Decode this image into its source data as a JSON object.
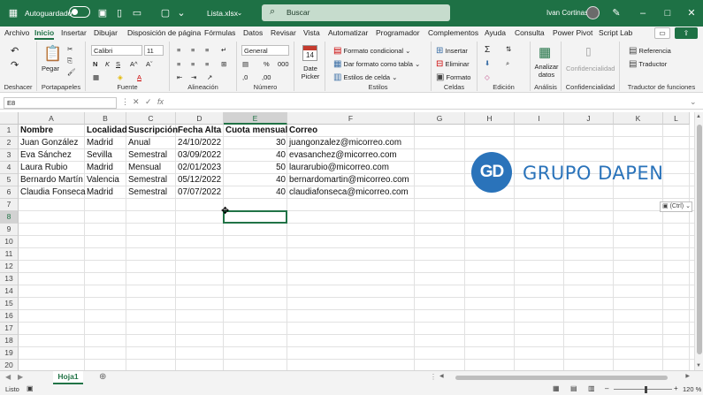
{
  "titlebar": {
    "autosave_label": "Autoguardado",
    "file_name": "Lista.xlsx",
    "search_placeholder": "Buscar",
    "user_name": "Ivan Cortinas"
  },
  "menu": {
    "tabs": [
      "Archivo",
      "Inicio",
      "Insertar",
      "Dibujar",
      "Disposición de página",
      "Fórmulas",
      "Datos",
      "Revisar",
      "Vista",
      "Automatizar",
      "Programador",
      "Complementos",
      "Ayuda",
      "Consulta",
      "Power Pivot",
      "Script Lab"
    ],
    "active_tab": "Inicio"
  },
  "ribbon": {
    "undo_group": "Deshacer",
    "clipboard": {
      "label": "Portapapeles",
      "paste": "Pegar"
    },
    "font": {
      "label": "Fuente",
      "name": "Calibri",
      "size": "11"
    },
    "alignment": {
      "label": "Alineación"
    },
    "number": {
      "label": "Número",
      "format": "General"
    },
    "date": {
      "day": "14",
      "label": "Date Picker"
    },
    "styles": {
      "label": "Estilos",
      "conditional": "Formato condicional",
      "as_table": "Dar formato como tabla",
      "cell_styles": "Estilos de celda"
    },
    "cells": {
      "label": "Celdas",
      "insert": "Insertar",
      "delete": "Eliminar",
      "format": "Formato"
    },
    "editing": {
      "label": "Edición"
    },
    "analysis": {
      "label": "Análisis",
      "analyze": "Analizar datos"
    },
    "confidentiality": {
      "label": "Confidencialidad",
      "button": "Confidencialidad"
    },
    "translator": {
      "label": "Traductor de funciones",
      "reference": "Referencia",
      "translator": "Traductor"
    }
  },
  "formula_bar": {
    "name_box": "E8",
    "formula": ""
  },
  "sheet": {
    "columns": [
      "A",
      "B",
      "C",
      "D",
      "E",
      "F",
      "G",
      "H",
      "I",
      "J",
      "K",
      "L"
    ],
    "selected_column": "E",
    "rows": [
      "1",
      "2",
      "3",
      "4",
      "5",
      "6",
      "7",
      "8",
      "9",
      "10",
      "11",
      "12",
      "13",
      "14",
      "15",
      "16",
      "17",
      "18",
      "19",
      "20"
    ],
    "selected_row": "8",
    "headers": [
      "Nombre",
      "Localidad",
      "Suscripción",
      "Fecha Alta",
      "Cuota mensual",
      "Correo"
    ],
    "data": [
      [
        "Juan González",
        "Madrid",
        "Anual",
        "24/10/2022",
        "30",
        "juangonzalez@micorreo.com"
      ],
      [
        "Eva Sánchez",
        "Sevilla",
        "Semestral",
        "03/09/2022",
        "40",
        "evasanchez@micorreo.com"
      ],
      [
        "Laura Rubio",
        "Madrid",
        "Mensual",
        "02/01/2023",
        "50",
        "laurarubio@micorreo.com"
      ],
      [
        "Bernardo Martín",
        "Valencia",
        "Semestral",
        "05/12/2022",
        "40",
        "bernardomartin@micorreo.com"
      ],
      [
        "Claudia Fonseca",
        "Madrid",
        "Semestral",
        "07/07/2022",
        "40",
        "claudiafonseca@micorreo.com"
      ]
    ],
    "paste_tag": "(Ctrl)"
  },
  "logo": {
    "initials": "GD",
    "text": "GRUPO DAPEN",
    "color": "#2a73ba"
  },
  "sheet_tabs": {
    "active": "Hoja1"
  },
  "status": {
    "ready": "Listo",
    "zoom": "120 %"
  },
  "colors": {
    "excel_green": "#1e7145",
    "accent": "#217346"
  }
}
